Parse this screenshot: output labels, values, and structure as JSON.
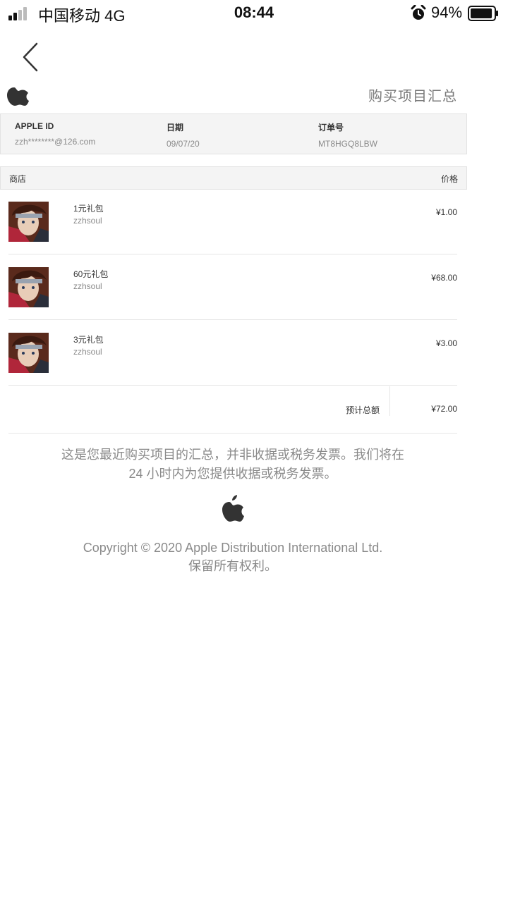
{
  "status_bar": {
    "carrier": "中国移动  4G",
    "time": "08:44",
    "battery": "94%",
    "battery_level": 0.94
  },
  "header": {
    "title": "购买项目汇总"
  },
  "info": {
    "apple_id_label": "APPLE ID",
    "apple_id_value": "zzh********@126.com",
    "date_label": "日期",
    "date_value": "09/07/20",
    "order_label": "订单号",
    "order_value": "MT8HGQ8LBW"
  },
  "table": {
    "store_label": "商店",
    "price_label": "价格",
    "items": [
      {
        "name": "1元礼包",
        "seller": "zzhsoul",
        "price": "¥1.00"
      },
      {
        "name": "60元礼包",
        "seller": "zzhsoul",
        "price": "¥68.00"
      },
      {
        "name": "3元礼包",
        "seller": "zzhsoul",
        "price": "¥3.00"
      }
    ],
    "total_label": "预计总额",
    "total_value": "¥72.00"
  },
  "footer": {
    "disclaimer_line1": "这是您最近购买项目的汇总，并非收据或税务发票。我们将在",
    "disclaimer_line2": "24 小时内为您提供收据或税务发票。",
    "copyright_line1": "Copyright © 2020 Apple Distribution International Ltd.",
    "copyright_line2": "保留所有权利。"
  },
  "icons": {
    "back": "chevron-left-icon",
    "apple": "apple-logo-icon",
    "alarm": "alarm-clock-icon",
    "signal": "signal-bars-icon",
    "battery": "battery-icon"
  }
}
